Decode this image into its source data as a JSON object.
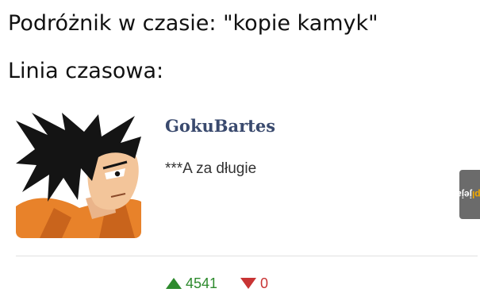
{
  "caption": {
    "line1": "Podróżnik w czasie: \"kopie kamyk\"",
    "line2": "Linia czasowa:"
  },
  "comment": {
    "username": "GokuBartes",
    "text": "***A za długie",
    "avatar_icon": "goku-avatar"
  },
  "votes": {
    "up_count": "4541",
    "down_count": "0",
    "up_color": "#2d8a2d",
    "down_color": "#c83434"
  },
  "watermark": {
    "name": "jeja",
    "tld": ".pl"
  }
}
